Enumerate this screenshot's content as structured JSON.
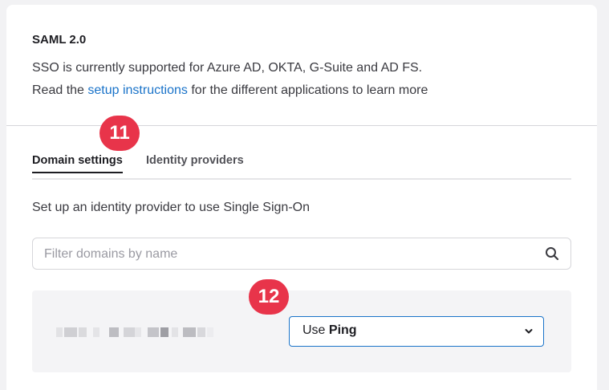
{
  "header": {
    "title": "SAML 2.0",
    "description_line1": "SSO is currently supported for Azure AD, OKTA, G-Suite and AD FS.",
    "description_line2_prefix": "Read the ",
    "description_link": "setup instructions",
    "description_line2_suffix": " for the different applications to learn more"
  },
  "tabs": [
    {
      "label": "Domain settings",
      "active": true
    },
    {
      "label": "Identity providers",
      "active": false
    }
  ],
  "badges": {
    "tab_step": "11",
    "select_step": "12"
  },
  "domain_section": {
    "subtitle": "Set up an identity provider to use Single Sign-On",
    "search_placeholder": "Filter domains by name",
    "search_value": ""
  },
  "domain_row": {
    "provider_prefix": "Use ",
    "provider_name": "Ping"
  },
  "colors": {
    "accent": "#1a73c9",
    "badge": "#e8344a"
  },
  "icons": {
    "search": "search-icon",
    "dropdown": "chevron-down-icon"
  }
}
